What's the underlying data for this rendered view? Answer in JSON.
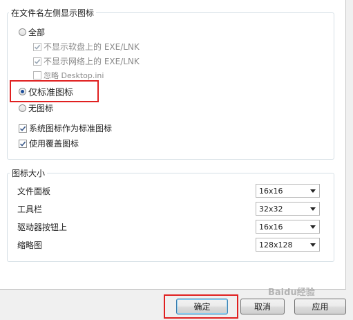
{
  "filename_icon_group": {
    "title": "在文件名左侧显示图标",
    "options": {
      "all": "全部",
      "hide_floppy": "不显示软盘上的 EXE/LNK",
      "hide_network": "不显示网络上的 EXE/LNK",
      "ignore_desktop_ini": "忽略 Desktop.ini",
      "standard_only": "仅标准图标",
      "no_icons": "无图标"
    },
    "selected": "standard_only",
    "checkboxes": {
      "system_as_standard": "系统图标作为标准图标",
      "use_overlay": "使用覆盖图标"
    },
    "checked": {
      "hide_floppy": true,
      "hide_network": true,
      "ignore_desktop_ini": false,
      "system_as_standard": true,
      "use_overlay": true
    }
  },
  "icon_size_group": {
    "title": "图标大小",
    "rows": [
      {
        "label": "文件面板",
        "value": "16x16"
      },
      {
        "label": "工具栏",
        "value": "32x32"
      },
      {
        "label": "驱动器按钮上",
        "value": "16x16"
      },
      {
        "label": "缩略图",
        "value": "128x128"
      }
    ]
  },
  "buttons": {
    "ok": "确定",
    "cancel": "取消",
    "apply": "应用"
  },
  "watermark": "Baidu经验",
  "colors": {
    "highlight": "#e02020",
    "radio_dot": "#1c4e9b"
  }
}
